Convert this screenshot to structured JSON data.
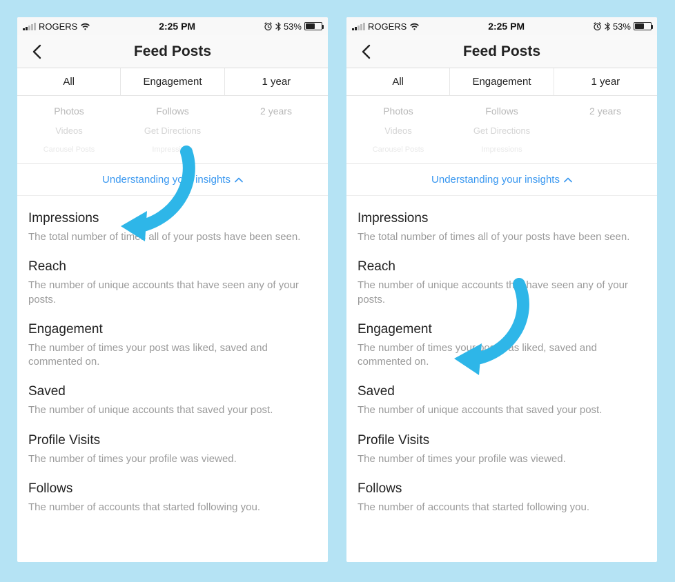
{
  "status": {
    "carrier": "ROGERS",
    "time": "2:25 PM",
    "battery_pct": "53%"
  },
  "nav": {
    "title": "Feed Posts"
  },
  "filters": {
    "col1_selected": "All",
    "col2_selected": "Engagement",
    "col3_selected": "1 year",
    "col1_opts": [
      "Photos",
      "Videos",
      "Carousel Posts"
    ],
    "col2_opts": [
      "Follows",
      "Get Directions",
      "Impressions"
    ],
    "col3_opts": [
      "2 years",
      "",
      ""
    ]
  },
  "toggle": {
    "label": "Understanding your insights"
  },
  "definitions": [
    {
      "title": "Impressions",
      "desc": "The total number of times all of your posts have been seen."
    },
    {
      "title": "Reach",
      "desc": "The number of unique accounts that have seen any of your posts."
    },
    {
      "title": "Engagement",
      "desc": "The number of times your post was liked, saved and commented on."
    },
    {
      "title": "Saved",
      "desc": "The number of unique accounts that saved your post."
    },
    {
      "title": "Profile Visits",
      "desc": "The number of times your profile was viewed."
    },
    {
      "title": "Follows",
      "desc": "The number of accounts that started following you."
    }
  ],
  "arrow_color": "#2eb6e8"
}
